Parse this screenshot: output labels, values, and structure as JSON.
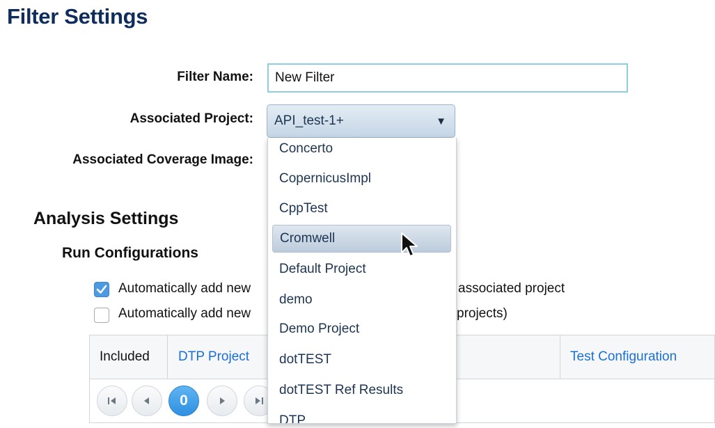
{
  "page": {
    "title": "Filter Settings"
  },
  "form": {
    "filter_name_label": "Filter Name:",
    "filter_name_value": "New Filter",
    "associated_project_label": "Associated Project:",
    "associated_project_value": "API_test-1+",
    "coverage_image_label": "Associated Coverage Image:"
  },
  "dropdown": {
    "items": [
      "Concerto",
      "CopernicusImpl",
      "CppTest",
      "Cromwell",
      "Default Project",
      "demo",
      "Demo Project",
      "dotTEST",
      "dotTEST Ref Results",
      "DTP"
    ],
    "highlighted": "Cromwell"
  },
  "analysis": {
    "title": "Analysis Settings",
    "run_config_title": "Run Configurations",
    "checkbox1_left": "Automatically add new",
    "checkbox1_right": "associated project",
    "checkbox1_checked": true,
    "checkbox2_left": "Automatically add new",
    "checkbox2_right": "projects)",
    "checkbox2_checked": false
  },
  "table": {
    "columns": [
      "Included",
      "DTP Project",
      "Test Configuration"
    ]
  },
  "pager": {
    "current_page": "0"
  },
  "colors": {
    "title": "#0f2d5c",
    "link": "#1a6fd8",
    "accent": "#4d9ae3"
  }
}
